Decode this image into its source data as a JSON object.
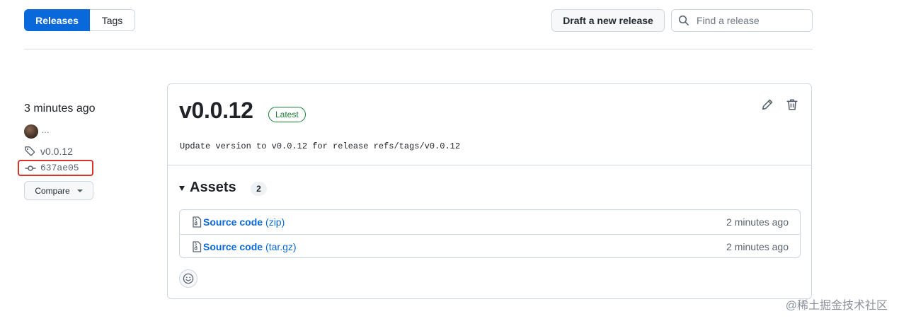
{
  "nav": {
    "tabs": [
      {
        "label": "Releases",
        "active": true
      },
      {
        "label": "Tags",
        "active": false
      }
    ],
    "draft_label": "Draft a new release",
    "search_placeholder": "Find a release"
  },
  "release": {
    "published": "3 minutes ago",
    "author": "…",
    "tag": "v0.0.12",
    "commit": "637ae05",
    "compare_label": "Compare",
    "title": "v0.0.12",
    "badge": "Latest",
    "body": "Update version to v0.0.12 for release refs/tags/v0.0.12",
    "assets_title": "Assets",
    "assets_count": "2",
    "assets": [
      {
        "name": "Source code",
        "ext": "(zip)",
        "time": "2 minutes ago"
      },
      {
        "name": "Source code",
        "ext": "(tar.gz)",
        "time": "2 minutes ago"
      }
    ]
  },
  "watermark": "@稀土掘金技术社区",
  "icons": {
    "search": "search-icon",
    "tag": "tag-icon",
    "commit": "git-commit-icon",
    "edit": "pencil-icon",
    "delete": "trash-icon",
    "file": "file-zip-icon",
    "reaction": "smiley-icon"
  },
  "colors": {
    "accent": "#0969da",
    "success": "#1a7f37",
    "highlight": "#d9342b"
  }
}
